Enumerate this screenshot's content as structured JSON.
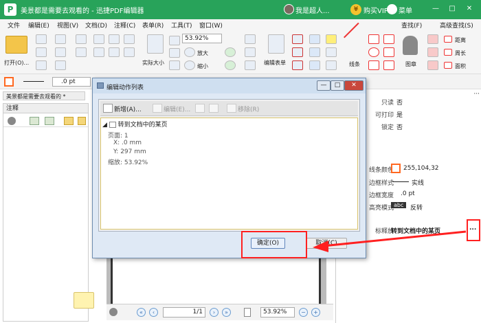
{
  "title_bar": {
    "logo_letter": "P",
    "title": "美景都是需要去观看的 - 迅捷PDF编辑器",
    "user": "我是超人...",
    "vip_coin": "¥",
    "vip": "购买VIP",
    "menu": "菜单",
    "min": "—",
    "max": "□",
    "close": "✕"
  },
  "menu_bar": {
    "items": [
      "文件",
      "编辑(E)",
      "视图(V)",
      "文档(D)",
      "注释(C)",
      "表单(R)",
      "工具(T)",
      "窗口(W)"
    ],
    "find": "查找(F)",
    "adv_find": "高级查找(S)"
  },
  "toolbar": {
    "open": "打开(O)...",
    "zoom": "53.92%",
    "actual_size": "实际大小",
    "zoom_in": "放大",
    "zoom_out": "缩小",
    "edit_form": "编辑表单",
    "line": "线条",
    "stamp": "图章",
    "distance": "距离",
    "perimeter": "周长",
    "area": "面积"
  },
  "toolbar2": {
    "stroke_width": ".0 pt"
  },
  "doc_tab": {
    "label": "美景都是需要去观看的 *"
  },
  "left_panel": {
    "header": "注释"
  },
  "dialog": {
    "title": "编辑动作列表",
    "minimize": "—",
    "restore": "□",
    "close": "✕",
    "new": "新增(A)...",
    "edit": "编辑(E)...",
    "remove": "移除(R)",
    "tree_title": "转到文档中的某页",
    "page_label": "页面: 1",
    "x_label": "X: .0 mm",
    "y_label": "Y: 297 mm",
    "zoom_label": "缩放: 53.92%",
    "ok": "确定(O)",
    "cancel": "取消(C)"
  },
  "properties": {
    "readonly_label": "只读",
    "readonly_val": "否",
    "printable_label": "可打印",
    "printable_val": "是",
    "locked_label": "锁定",
    "locked_val": "否",
    "line_color_label": "线条颜色",
    "line_color_val": "255,104,32",
    "border_style_label": "边框样式",
    "border_style_val": "实线",
    "border_width_label": "边框宽度",
    "border_width_val": ".0 pt",
    "highlight_label": "高亮模式",
    "highlight_badge": "abc",
    "highlight_val": "反转",
    "mouse_release_label": "标释放",
    "mouse_release_val": "转到文档中的某页",
    "more": "..."
  },
  "nav_bar": {
    "page_box": "1/1",
    "zoom_box": "53.92%"
  },
  "colors": {
    "title_green": "#28a35a",
    "line_color": "#ff6820",
    "annotation_red": "#ff2020"
  }
}
